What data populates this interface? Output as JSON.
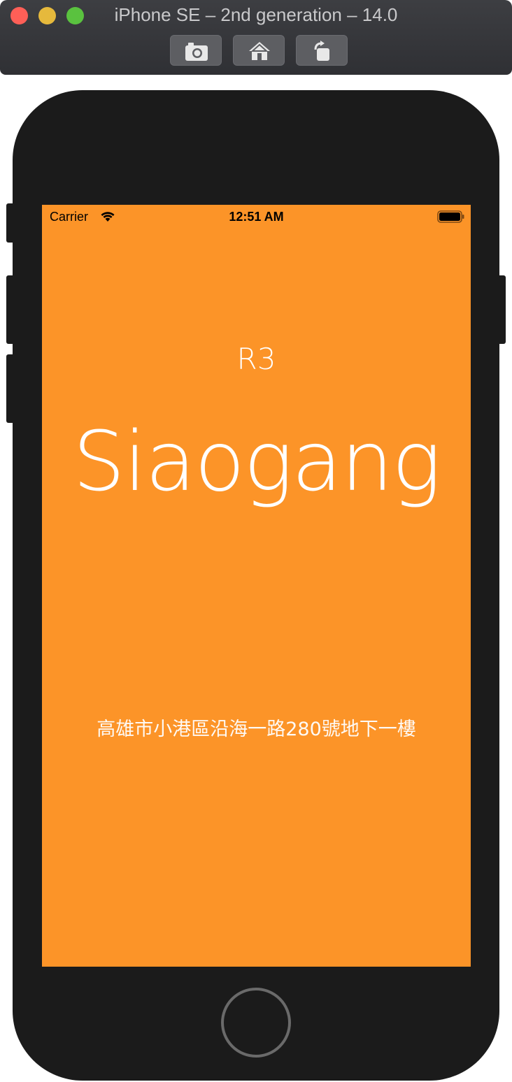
{
  "window": {
    "title": "iPhone SE – 2nd generation – 14.0",
    "toolbar": {
      "screenshot_icon": "camera-icon",
      "home_icon": "home-icon",
      "rotate_icon": "rotate-icon"
    }
  },
  "status_bar": {
    "carrier": "Carrier",
    "time": "12:51 AM",
    "wifi_icon": "wifi-icon",
    "battery_icon": "battery-icon"
  },
  "content": {
    "line_code": "R3",
    "station_name": "Siaogang",
    "address": "高雄市小港區沿海一路280號地下一樓"
  },
  "colors": {
    "screen_background": "#fc9428",
    "text": "#ffffff",
    "device_body": "#1b1b1b"
  }
}
